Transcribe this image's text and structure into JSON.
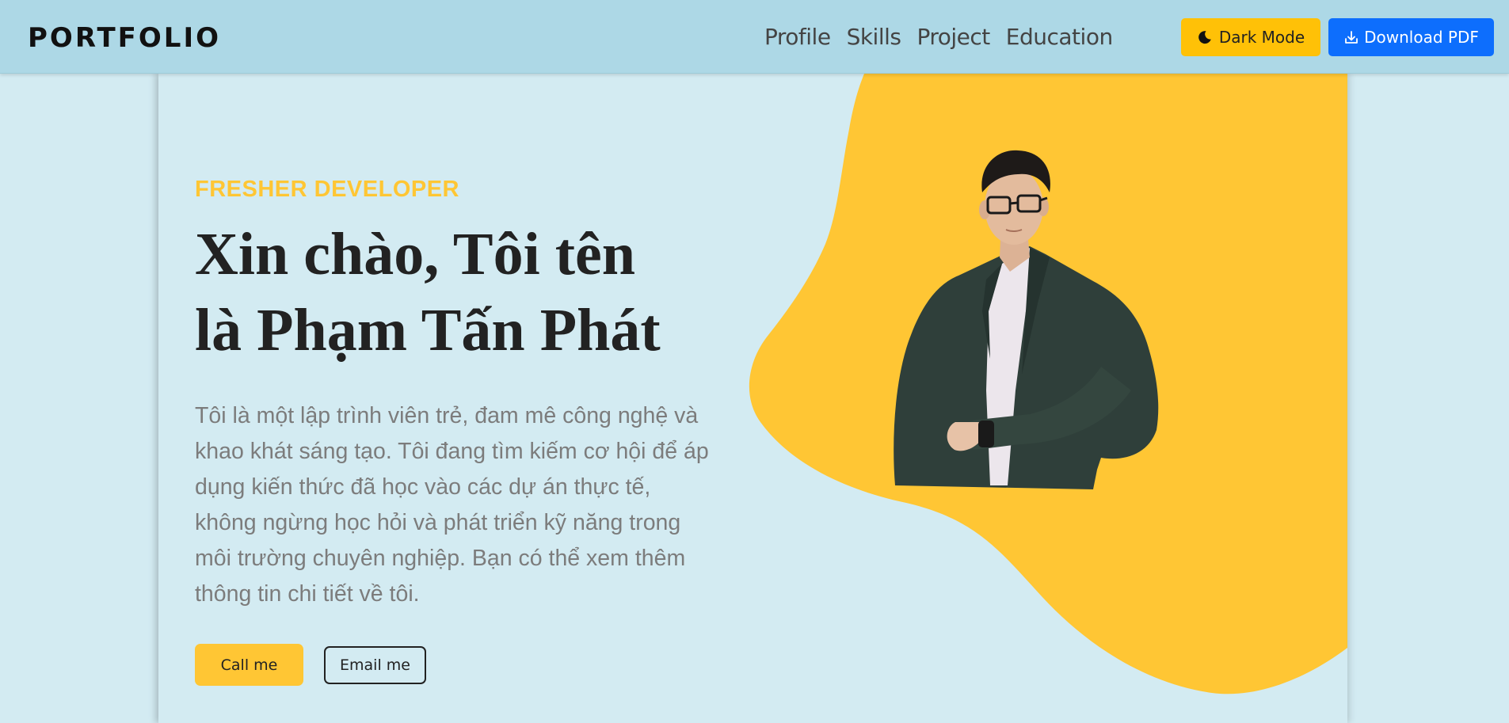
{
  "navbar": {
    "brand": "PORTFOLIO",
    "links": [
      "Profile",
      "Skills",
      "Project",
      "Education"
    ],
    "dark_mode_label": "Dark Mode",
    "download_label": "Download PDF"
  },
  "hero": {
    "eyebrow": "FRESHER DEVELOPER",
    "headline_line1": "Xin chào, Tôi tên",
    "headline_line2": "là Phạm Tấn Phát",
    "bio": "Tôi là một lập trình viên trẻ, đam mê công nghệ và khao khát sáng tạo. Tôi đang tìm kiếm cơ hội để áp dụng kiến thức đã học vào các dự án thực tế, không ngừng học hỏi và phát triển kỹ năng trong môi trường chuyên nghiệp. Bạn có thể xem thêm thông tin chi tiết về tôi.",
    "call_label": "Call me",
    "email_label": "Email me"
  },
  "icons": {
    "dark_mode": "moon-icon",
    "download": "download-icon"
  },
  "colors": {
    "navbar_bg": "#add8e6",
    "page_bg": "#d3ebf2",
    "accent_yellow": "#ffc634",
    "primary_blue": "#0d6efd",
    "heading": "#222222",
    "body_text": "#7c7c7c"
  }
}
